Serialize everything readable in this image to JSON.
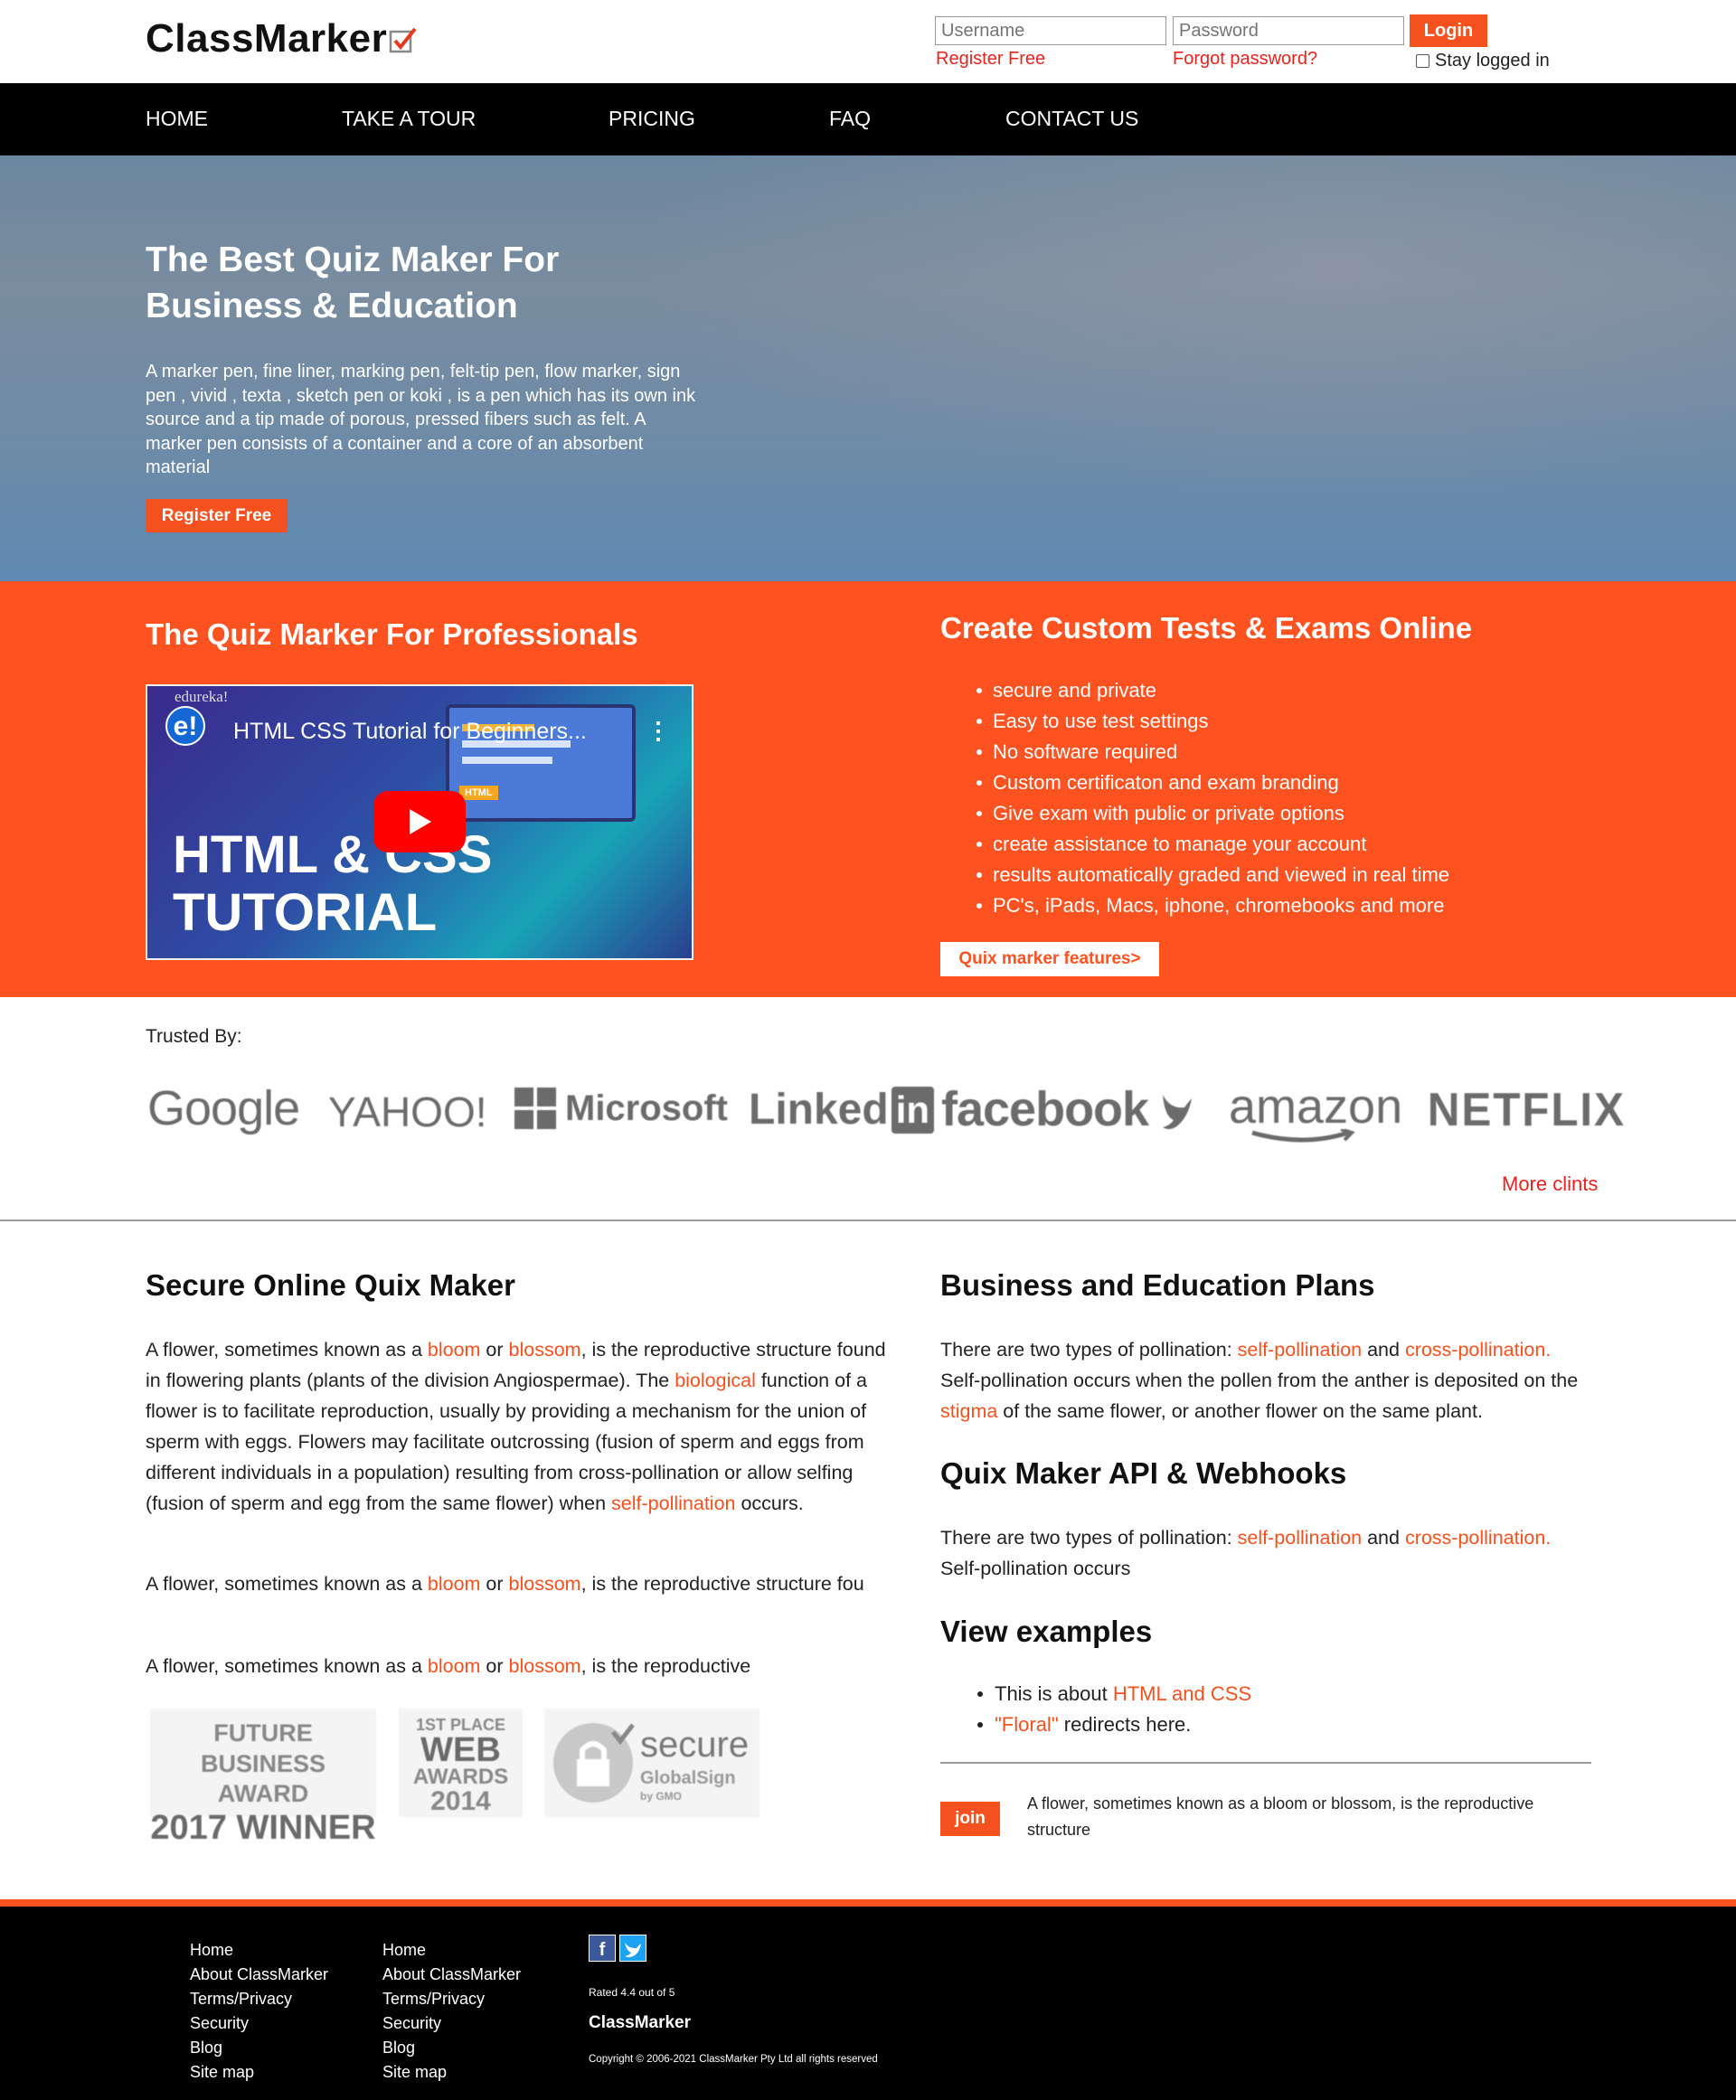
{
  "header": {
    "logo_text": "ClassMarker",
    "username_placeholder": "Username",
    "password_placeholder": "Password",
    "login_label": "Login",
    "register_label": "Register Free",
    "forgot_label": "Forgot password?",
    "stay_logged_label": "Stay logged in"
  },
  "nav": {
    "items": [
      "HOME",
      "TAKE A TOUR",
      "PRICING",
      "FAQ",
      "CONTACT US"
    ]
  },
  "hero": {
    "title_line1": "The Best Quiz Maker For",
    "title_line2": "Business & Education",
    "text": "A marker pen, fine liner, marking pen, felt-tip pen, flow marker, sign pen , vivid , texta , sketch pen or koki , is a pen which has its own ink source and a tip made of porous, pressed fibers such as felt. A marker pen consists of a container and a core of an absorbent material",
    "button": "Register Free"
  },
  "professionals": {
    "title": "The Quiz Marker For Professionals",
    "video": {
      "channel": "edureka!",
      "logo": "e!",
      "title": "HTML CSS Tutorial for Beginners...",
      "badge": "HTML",
      "big_line1": "HTML & CSS",
      "big_line2": "TUTORIAL"
    }
  },
  "custom_tests": {
    "title": "Create Custom Tests & Exams Online",
    "features": [
      "secure and private",
      "Easy to use test settings",
      "No software required",
      "Custom certificaton and exam branding",
      "Give exam with public or private options",
      "create assistance to manage your account",
      "results automatically graded and viewed in real time",
      "PC's, iPads, Macs, iphone, chromebooks and more"
    ],
    "button": "Quix marker features>"
  },
  "trusted": {
    "label": "Trusted By:",
    "brands": [
      "Google",
      "YAHOO!",
      "Microsoft",
      "Linked",
      "in",
      "facebook",
      "amazon",
      "NETFLIX"
    ],
    "more_link": "More clints"
  },
  "secure": {
    "title": "Secure Online Quix Maker",
    "para1": {
      "t1": "A flower, sometimes known as a ",
      "l1": "bloom",
      "t2": " or ",
      "l2": "blossom",
      "t3": ", is the reproductive structure found in flowering plants (plants of the division Angiospermae). The ",
      "l3": "biological",
      "t4": " function of a flower is to facilitate reproduction, usually by providing a mechanism for the union of sperm with eggs. Flowers may facilitate outcrossing (fusion of sperm and eggs from different individuals in a population) resulting from cross-pollination or allow selfing (fusion of sperm and egg from the same flower) when ",
      "l4": "self-pollination",
      "t5": " occurs."
    },
    "para2": {
      "t1": "A flower, sometimes known as a ",
      "l1": "bloom",
      "t2": " or ",
      "l2": "blossom",
      "t3": ", is the reproductive structure fou"
    },
    "para3": {
      "t1": "A flower, sometimes known as a ",
      "l1": "bloom",
      "t2": " or ",
      "l2": "blossom",
      "t3": ", is the reproductive"
    },
    "badges": {
      "award_l1": "FUTURE BUSINESS",
      "award_l2": "AWARD",
      "award_l3": "2017 WINNER",
      "web_l1": "1ST PLACE",
      "web_l2": "WEB",
      "web_l3": "AWARDS",
      "web_l4": "2014",
      "secure_l1": "secure",
      "secure_l2": "GlobalSign",
      "secure_l3": "by GMO"
    }
  },
  "plans": {
    "title": "Business and Education Plans",
    "t1": "There are two types of pollination: ",
    "l1": "self-pollination",
    "t2": " and ",
    "l2": "cross-pollination.",
    "t3": " Self-pollination occurs when the pollen from the anther is deposited on the ",
    "l3": "stigma",
    "t4": " of the same flower, or another flower on the same plant."
  },
  "api": {
    "title": "Quix Maker API & Webhooks",
    "t1": "There are two types of pollination: ",
    "l1": "self-pollination",
    "t2": " and ",
    "l2": "cross-pollination.",
    "t3": " Self-pollination occurs"
  },
  "examples": {
    "title": "View examples",
    "item1_text": "This is about ",
    "item1_link": "HTML and CSS",
    "item2_link": "\"Floral\"",
    "item2_text": " redirects here."
  },
  "join": {
    "button": "join",
    "text": "A flower, sometimes known as a bloom or blossom, is the reproductive structure"
  },
  "footer": {
    "col1": [
      "Home",
      "About ClassMarker",
      "Terms/Privacy",
      "Security",
      "Blog",
      "Site map"
    ],
    "col2": [
      "Home",
      "About ClassMarker",
      "Terms/Privacy",
      "Security",
      "Blog",
      "Site map"
    ],
    "social_fb": "f",
    "rated": "Rated 4.4 out of 5",
    "brand": "ClassMarker",
    "copyright": "Copyright © 2006-2021 ClassMarker Pty Ltd all rights reserved"
  },
  "colors": {
    "accent": "#fe5321",
    "link": "#f4511e",
    "nav_bg": "#000000",
    "red_link": "#e6241f"
  }
}
